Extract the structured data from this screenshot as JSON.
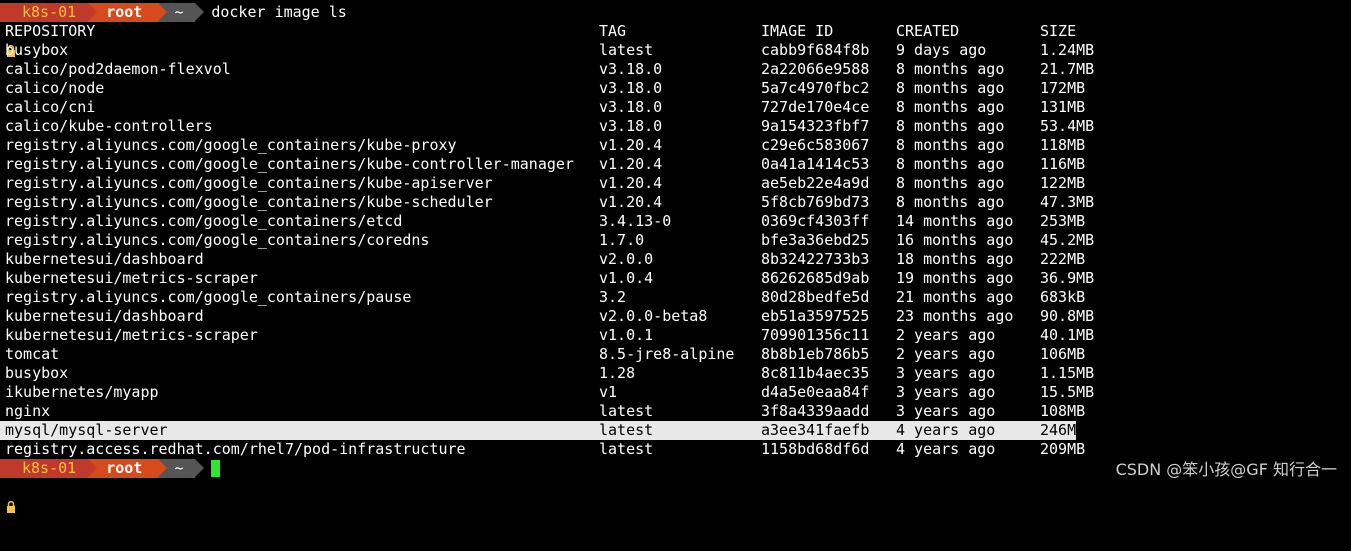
{
  "prompt": {
    "host": "k8s-01",
    "user": "root",
    "dir": "~",
    "command": "docker image ls",
    "colors": {
      "host_bg": "#c0392b",
      "host_fg": "#f5c242",
      "user_bg": "#d64a1c",
      "dir_bg": "#555555",
      "cursor": "#2ee82e"
    },
    "icon": "lock-icon"
  },
  "table": {
    "headers": {
      "repository": "REPOSITORY",
      "tag": "TAG",
      "image_id": "IMAGE ID",
      "created": "CREATED",
      "size": "SIZE"
    },
    "rows": [
      {
        "repository": "busybox",
        "tag": "latest",
        "image_id": "cabb9f684f8b",
        "created": "9 days ago",
        "size": "1.24MB"
      },
      {
        "repository": "calico/pod2daemon-flexvol",
        "tag": "v3.18.0",
        "image_id": "2a22066e9588",
        "created": "8 months ago",
        "size": "21.7MB"
      },
      {
        "repository": "calico/node",
        "tag": "v3.18.0",
        "image_id": "5a7c4970fbc2",
        "created": "8 months ago",
        "size": "172MB"
      },
      {
        "repository": "calico/cni",
        "tag": "v3.18.0",
        "image_id": "727de170e4ce",
        "created": "8 months ago",
        "size": "131MB"
      },
      {
        "repository": "calico/kube-controllers",
        "tag": "v3.18.0",
        "image_id": "9a154323fbf7",
        "created": "8 months ago",
        "size": "53.4MB"
      },
      {
        "repository": "registry.aliyuncs.com/google_containers/kube-proxy",
        "tag": "v1.20.4",
        "image_id": "c29e6c583067",
        "created": "8 months ago",
        "size": "118MB"
      },
      {
        "repository": "registry.aliyuncs.com/google_containers/kube-controller-manager",
        "tag": "v1.20.4",
        "image_id": "0a41a1414c53",
        "created": "8 months ago",
        "size": "116MB"
      },
      {
        "repository": "registry.aliyuncs.com/google_containers/kube-apiserver",
        "tag": "v1.20.4",
        "image_id": "ae5eb22e4a9d",
        "created": "8 months ago",
        "size": "122MB"
      },
      {
        "repository": "registry.aliyuncs.com/google_containers/kube-scheduler",
        "tag": "v1.20.4",
        "image_id": "5f8cb769bd73",
        "created": "8 months ago",
        "size": "47.3MB"
      },
      {
        "repository": "registry.aliyuncs.com/google_containers/etcd",
        "tag": "3.4.13-0",
        "image_id": "0369cf4303ff",
        "created": "14 months ago",
        "size": "253MB"
      },
      {
        "repository": "registry.aliyuncs.com/google_containers/coredns",
        "tag": "1.7.0",
        "image_id": "bfe3a36ebd25",
        "created": "16 months ago",
        "size": "45.2MB"
      },
      {
        "repository": "kubernetesui/dashboard",
        "tag": "v2.0.0",
        "image_id": "8b32422733b3",
        "created": "18 months ago",
        "size": "222MB"
      },
      {
        "repository": "kubernetesui/metrics-scraper",
        "tag": "v1.0.4",
        "image_id": "86262685d9ab",
        "created": "19 months ago",
        "size": "36.9MB"
      },
      {
        "repository": "registry.aliyuncs.com/google_containers/pause",
        "tag": "3.2",
        "image_id": "80d28bedfe5d",
        "created": "21 months ago",
        "size": "683kB"
      },
      {
        "repository": "kubernetesui/dashboard",
        "tag": "v2.0.0-beta8",
        "image_id": "eb51a3597525",
        "created": "23 months ago",
        "size": "90.8MB"
      },
      {
        "repository": "kubernetesui/metrics-scraper",
        "tag": "v1.0.1",
        "image_id": "709901356c11",
        "created": "2 years ago",
        "size": "40.1MB"
      },
      {
        "repository": "tomcat",
        "tag": "8.5-jre8-alpine",
        "image_id": "8b8b1eb786b5",
        "created": "2 years ago",
        "size": "106MB"
      },
      {
        "repository": "busybox",
        "tag": "1.28",
        "image_id": "8c811b4aec35",
        "created": "3 years ago",
        "size": "1.15MB"
      },
      {
        "repository": "ikubernetes/myapp",
        "tag": "v1",
        "image_id": "d4a5e0eaa84f",
        "created": "3 years ago",
        "size": "15.5MB"
      },
      {
        "repository": "nginx",
        "tag": "latest",
        "image_id": "3f8a4339aadd",
        "created": "3 years ago",
        "size": "108MB"
      },
      {
        "repository": "mysql/mysql-server",
        "tag": "latest",
        "image_id": "a3ee341faefb",
        "created": "4 years ago",
        "size": "246MB",
        "selected": true
      },
      {
        "repository": "registry.access.redhat.com/rhel7/pod-infrastructure",
        "tag": "latest",
        "image_id": "1158bd68df6d",
        "created": "4 years ago",
        "size": "209MB"
      }
    ],
    "selection_color": "#e8e8e8"
  },
  "watermark": "CSDN @笨小孩@GF 知行合一"
}
